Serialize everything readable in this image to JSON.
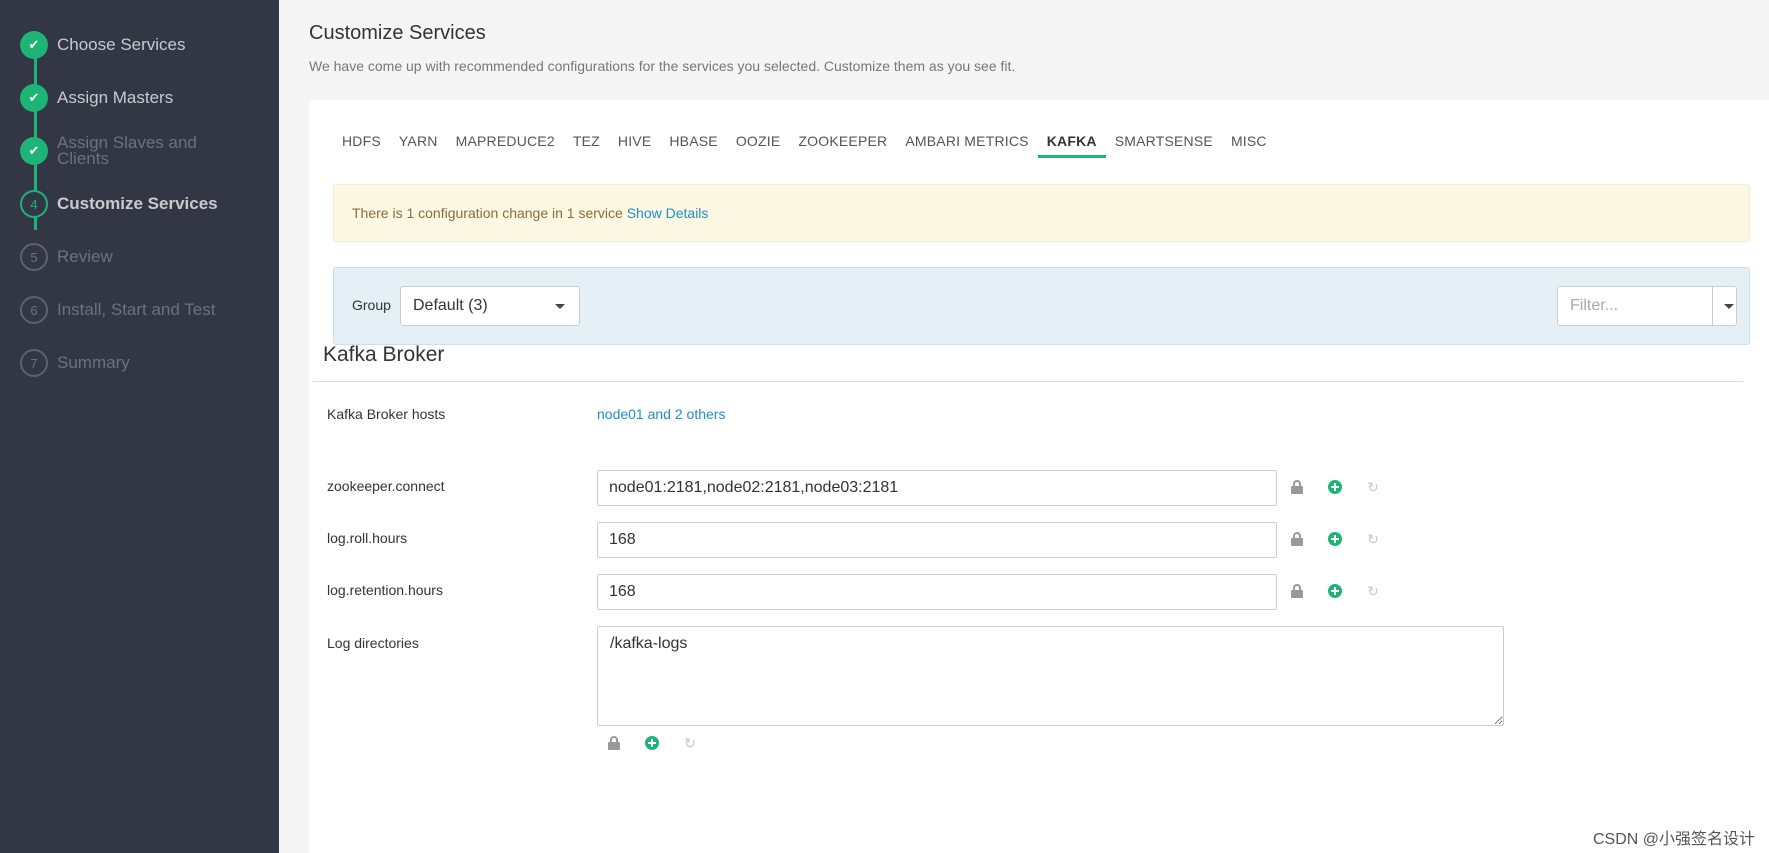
{
  "wizard": {
    "steps": [
      {
        "number": "1",
        "label": "Choose Services",
        "state": "done"
      },
      {
        "number": "2",
        "label": "Assign Masters",
        "state": "done"
      },
      {
        "number": "3",
        "label": "Assign Slaves and Clients",
        "state": "done"
      },
      {
        "number": "4",
        "label": "Customize Services",
        "state": "active"
      },
      {
        "number": "5",
        "label": "Review",
        "state": "todo"
      },
      {
        "number": "6",
        "label": "Install, Start and Test",
        "state": "todo"
      },
      {
        "number": "7",
        "label": "Summary",
        "state": "todo"
      }
    ]
  },
  "header": {
    "title": "Customize Services",
    "subtitle": "We have come up with recommended configurations for the services you selected. Customize them as you see fit."
  },
  "tabs": [
    {
      "label": "HDFS",
      "active": false
    },
    {
      "label": "YARN",
      "active": false
    },
    {
      "label": "MAPREDUCE2",
      "active": false
    },
    {
      "label": "TEZ",
      "active": false
    },
    {
      "label": "HIVE",
      "active": false
    },
    {
      "label": "HBASE",
      "active": false
    },
    {
      "label": "OOZIE",
      "active": false
    },
    {
      "label": "ZOOKEEPER",
      "active": false
    },
    {
      "label": "AMBARI METRICS",
      "active": false
    },
    {
      "label": "KAFKA",
      "active": true
    },
    {
      "label": "SMARTSENSE",
      "active": false
    },
    {
      "label": "MISC",
      "active": false
    }
  ],
  "alert": {
    "text": "There is 1 configuration change in 1 service",
    "link": "Show Details"
  },
  "group": {
    "label": "Group",
    "selected": "Default (3)"
  },
  "filter": {
    "placeholder": "Filter..."
  },
  "section": {
    "title": "Kafka Broker",
    "hosts_label": "Kafka Broker hosts",
    "hosts_value": "node01 and 2 others"
  },
  "properties": {
    "zookeeper_connect": {
      "label": "zookeeper.connect",
      "value": "node01:2181,node02:2181,node03:2181"
    },
    "log_roll_hours": {
      "label": "log.roll.hours",
      "value": "168"
    },
    "log_retention_hours": {
      "label": "log.retention.hours",
      "value": "168"
    },
    "log_dirs": {
      "label": "Log directories",
      "value": "/kafka-logs"
    }
  },
  "icons": {
    "lock": "lock-icon",
    "add": "plus-circle-icon",
    "undo": "undo-icon"
  },
  "colors": {
    "accent": "#1eb475",
    "link": "#1d8ec7",
    "sidebar": "#333745"
  },
  "watermark": "CSDN @小强签名设计"
}
